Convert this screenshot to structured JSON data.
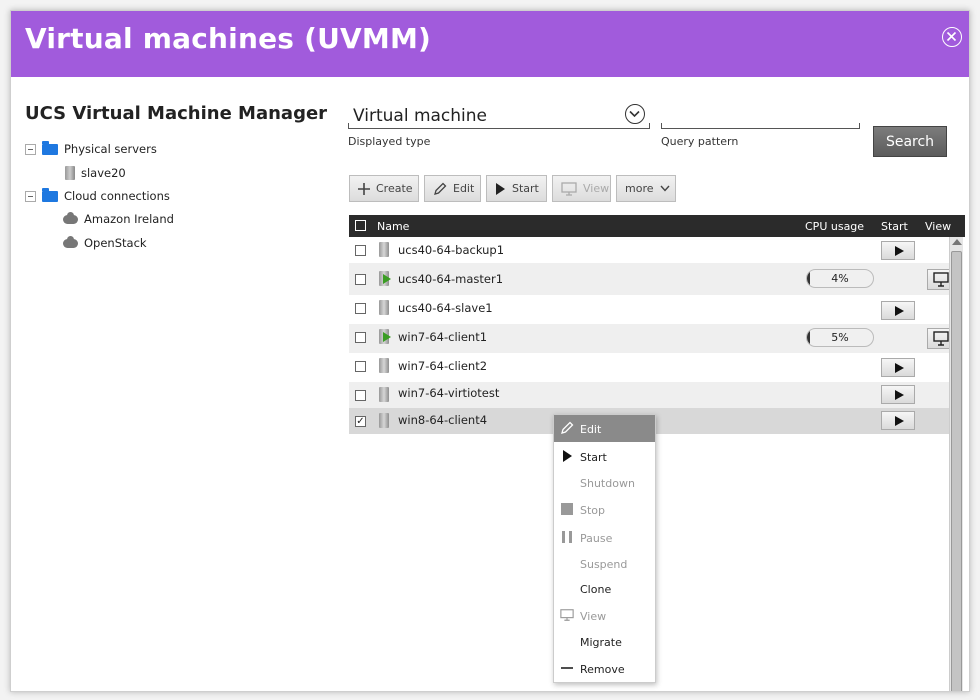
{
  "window": {
    "title": "Virtual machines (UVMM)"
  },
  "left_panel": {
    "title": "UCS Virtual Machine Manager",
    "tree": [
      {
        "label": "Physical servers",
        "icon": "folder-icon"
      },
      {
        "label": "slave20",
        "icon": "server-icon"
      },
      {
        "label": "Cloud connections",
        "icon": "folder-icon"
      },
      {
        "label": "Amazon Ireland",
        "icon": "cloud-icon"
      },
      {
        "label": "OpenStack",
        "icon": "cloud-icon"
      }
    ]
  },
  "search": {
    "type_value": "Virtual machine",
    "type_label": "Displayed type",
    "query_value": "",
    "query_label": "Query pattern",
    "button": "Search"
  },
  "toolbar": {
    "create": "Create",
    "edit": "Edit",
    "start": "Start",
    "view": "View",
    "more": "more"
  },
  "grid": {
    "columns": {
      "name": "Name",
      "cpu": "CPU usage",
      "start": "Start",
      "view": "View"
    },
    "rows": [
      {
        "name": "ucs40-64-backup1",
        "running": false,
        "cpu": "",
        "checked": false
      },
      {
        "name": "ucs40-64-master1",
        "running": true,
        "cpu": "4%",
        "cpu_fraction": 0.04,
        "checked": false
      },
      {
        "name": "ucs40-64-slave1",
        "running": false,
        "cpu": "",
        "checked": false
      },
      {
        "name": "win7-64-client1",
        "running": true,
        "cpu": "5%",
        "cpu_fraction": 0.05,
        "checked": false
      },
      {
        "name": "win7-64-client2",
        "running": false,
        "cpu": "",
        "checked": false
      },
      {
        "name": "win7-64-virtiotest",
        "running": false,
        "cpu": "",
        "checked": false
      },
      {
        "name": "win8-64-client4",
        "running": false,
        "cpu": "",
        "checked": true
      }
    ]
  },
  "context_menu": {
    "items": [
      {
        "label": "Edit",
        "icon": "pencil-icon",
        "enabled": true,
        "active": true
      },
      {
        "label": "Start",
        "icon": "play-icon",
        "enabled": true
      },
      {
        "label": "Shutdown",
        "icon": "",
        "enabled": false
      },
      {
        "label": "Stop",
        "icon": "stop-icon",
        "enabled": false
      },
      {
        "label": "Pause",
        "icon": "pause-icon",
        "enabled": false
      },
      {
        "label": "Suspend",
        "icon": "",
        "enabled": false
      },
      {
        "label": "Clone",
        "icon": "",
        "enabled": true
      },
      {
        "label": "View",
        "icon": "monitor-icon",
        "enabled": false
      },
      {
        "label": "Migrate",
        "icon": "",
        "enabled": true
      },
      {
        "label": "Remove",
        "icon": "minus-icon",
        "enabled": true
      }
    ]
  },
  "colors": {
    "titlebar": "#a15bdc",
    "grid_header": "#2b2b2b",
    "running": "#3a9d23"
  }
}
